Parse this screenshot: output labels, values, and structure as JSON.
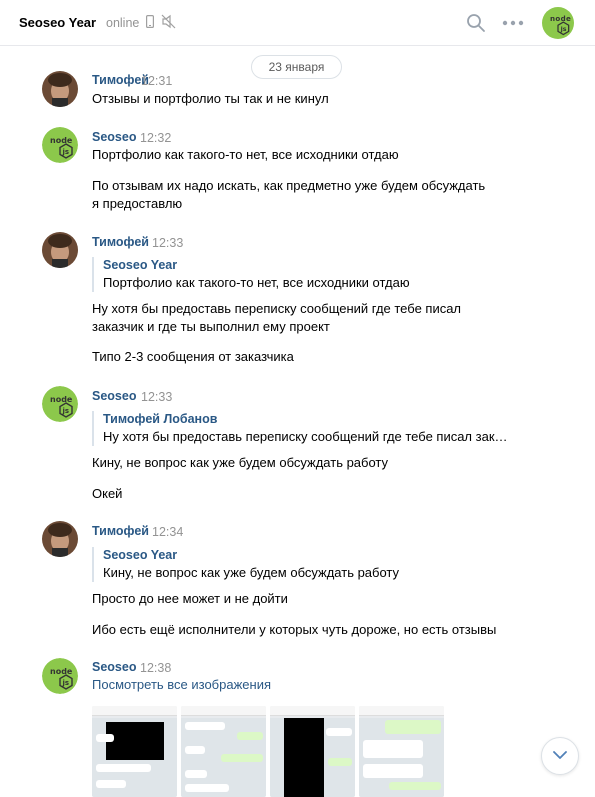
{
  "header": {
    "title": "Seoseo Year",
    "status": "online"
  },
  "date_separator": "23 января",
  "messages": [
    {
      "author": "Тимофей",
      "time": "12:31",
      "avatar": "person-photo",
      "lines": [
        "Отзывы и портфолио ты так и не кинул"
      ]
    },
    {
      "author": "Seoseo",
      "time": "12:32",
      "avatar": "nodejs-logo",
      "lines": [
        "Портфолио как такого-то нет, все исходники отдаю",
        "По отзывам их надо искать, как предметно уже будем обсуждать",
        "я предоставлю"
      ]
    },
    {
      "author": "Тимофей",
      "time": "12:33",
      "avatar": "person-photo",
      "reply": {
        "author": "Seoseo Year",
        "text": "Портфолио как такого-то нет, все исходники отдаю"
      },
      "lines": [
        "Ну хотя бы предоставь переписку сообщений где тебе писал",
        "заказчик и где ты выполнил ему проект",
        "Типо 2-3 сообщения от заказчика"
      ]
    },
    {
      "author": "Seoseo",
      "time": "12:33",
      "avatar": "nodejs-logo",
      "reply": {
        "author": "Тимофей Лобанов",
        "text": "Ну хотя бы предоставь переписку сообщений где тебе писал зак…"
      },
      "lines": [
        "Кину, не вопрос как уже будем обсуждать работу",
        "Окей"
      ]
    },
    {
      "author": "Тимофей",
      "time": "12:34",
      "avatar": "person-photo",
      "reply": {
        "author": "Seoseo Year",
        "text": "Кину, не вопрос как уже будем обсуждать работу"
      },
      "lines": [
        "Просто до нее может и не дойти",
        "Ибо есть ещё исполнители у которых чуть дороже, но есть отзывы"
      ]
    },
    {
      "author": "Seoseo",
      "time": "12:38",
      "avatar": "nodejs-logo",
      "link": "Посмотреть все изображения",
      "attachments": [
        "screenshot-1",
        "screenshot-2",
        "screenshot-3",
        "screenshot-4"
      ]
    }
  ],
  "colors": {
    "link": "#2a5885",
    "muted": "#939393",
    "node_green": "#8cc84b"
  }
}
